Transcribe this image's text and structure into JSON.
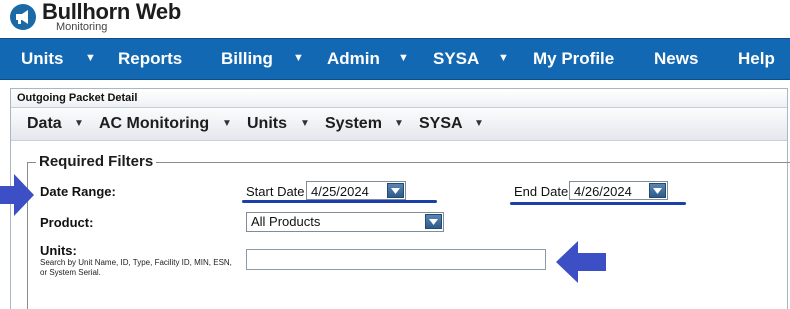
{
  "brand": {
    "name": "Bullhorn Web",
    "subtitle": "Monitoring",
    "color": "#1a6aa8",
    "icon": "megaphone-icon"
  },
  "main_nav": {
    "background": "#1268b3",
    "items": [
      {
        "label": "Units",
        "has_dropdown": true
      },
      {
        "label": "Reports",
        "has_dropdown": false
      },
      {
        "label": "Billing",
        "has_dropdown": true
      },
      {
        "label": "Admin",
        "has_dropdown": true
      },
      {
        "label": "SYSA",
        "has_dropdown": true
      },
      {
        "label": "My Profile",
        "has_dropdown": false
      },
      {
        "label": "News",
        "has_dropdown": false
      },
      {
        "label": "Help",
        "has_dropdown": false
      }
    ]
  },
  "panel": {
    "title": "Outgoing Packet Detail",
    "subnav": [
      {
        "label": "Data",
        "has_dropdown": true
      },
      {
        "label": "AC Monitoring",
        "has_dropdown": true
      },
      {
        "label": "Units",
        "has_dropdown": true
      },
      {
        "label": "System",
        "has_dropdown": true
      },
      {
        "label": "SYSA",
        "has_dropdown": true
      }
    ]
  },
  "filters": {
    "legend": "Required Filters",
    "date_range_label": "Date Range:",
    "start_date_label": "Start Date",
    "start_date_value": "4/25/2024",
    "end_date_label": "End Date",
    "end_date_value": "4/26/2024",
    "product_label": "Product:",
    "product_value": "All Products",
    "units_label": "Units:",
    "units_hint": "Search by Unit Name, ID, Type, Facility ID, MIN, ESN, or System Serial.",
    "units_value": ""
  },
  "annotation_color": "#3d4fc4"
}
